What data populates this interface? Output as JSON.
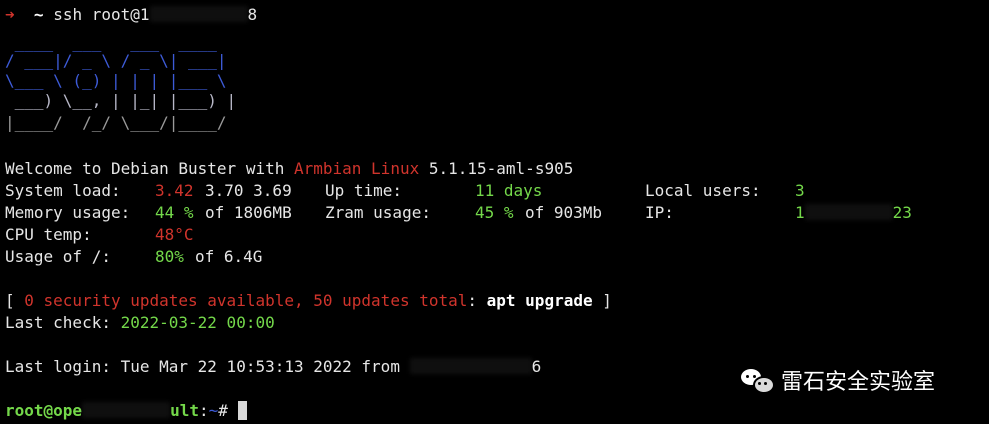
{
  "prompt": {
    "arrow": "➜",
    "tilde": "~",
    "command_prefix": "ssh root@1",
    "command_suffix": "8"
  },
  "banner": {
    "line1": " ____  ___   ___  ____",
    "line2": "/ ___|/ _ \\ / _ \\| ___|",
    "line3": "\\___ \\ (_) | | | |___ \\",
    "line4": " ___) \\__, | |_| |___) |",
    "line5": "|____/  /_/ \\___/|____/"
  },
  "welcome": {
    "prefix": "Welcome to Debian Buster with ",
    "distro": "Armbian Linux",
    "kernel": " 5.1.15-aml-s905"
  },
  "stats": {
    "system_load_label": "System load:",
    "load_1": "3.42",
    "load_rest": "3.70 3.69",
    "uptime_label": "Up time:",
    "uptime_value": "11 days",
    "local_users_label": "Local users:",
    "local_users_value": "3",
    "memory_label": "Memory usage:",
    "memory_pct": "44 %",
    "memory_rest": "of 1806MB",
    "zram_label": "Zram usage:",
    "zram_pct": "45 %",
    "zram_rest": "of 903Mb",
    "ip_label": "IP:",
    "ip_prefix": "1",
    "ip_suffix": "23",
    "cpu_label": "CPU temp:",
    "cpu_value": "48°C",
    "disk_label": "Usage of /:",
    "disk_pct": "80%",
    "disk_rest": "of 6.4G"
  },
  "updates": {
    "open_bracket": "[ ",
    "security": "0 security updates available, 50 updates total",
    "colon": ": ",
    "command": "apt upgrade",
    "close_bracket": " ]"
  },
  "last_check": {
    "label": "Last check: ",
    "value": "2022-03-22 00:00"
  },
  "last_login": {
    "text": "Last login: Tue Mar 22 10:53:13 2022 from ",
    "suffix": "6"
  },
  "shell_prompt": {
    "user_host_prefix": "root@ope",
    "host_suffix": "ult",
    "sep": ":",
    "path": "~",
    "symbol": "# "
  },
  "watermark": {
    "text": "雷石安全实验室"
  },
  "colors": {
    "background": "#000000",
    "banner_blue": "#3d5bd8",
    "banner_gray": "#9a9a9a",
    "red": "#d0342c",
    "green": "#74d84a",
    "text": "#e6e6e6"
  }
}
